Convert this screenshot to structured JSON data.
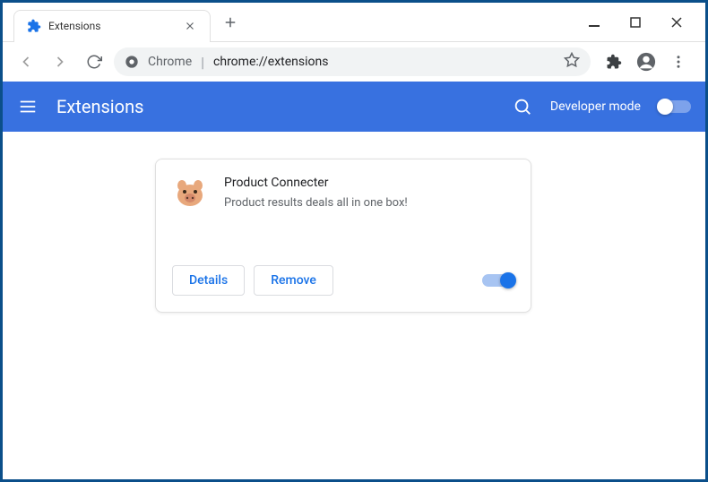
{
  "window": {
    "tab_title": "Extensions",
    "omnibox_label": "Chrome",
    "omnibox_url": "chrome://extensions"
  },
  "header": {
    "title": "Extensions",
    "devmode_label": "Developer mode"
  },
  "extension": {
    "name": "Product Connecter",
    "description": "Product results deals all in one box!",
    "details_label": "Details",
    "remove_label": "Remove"
  }
}
